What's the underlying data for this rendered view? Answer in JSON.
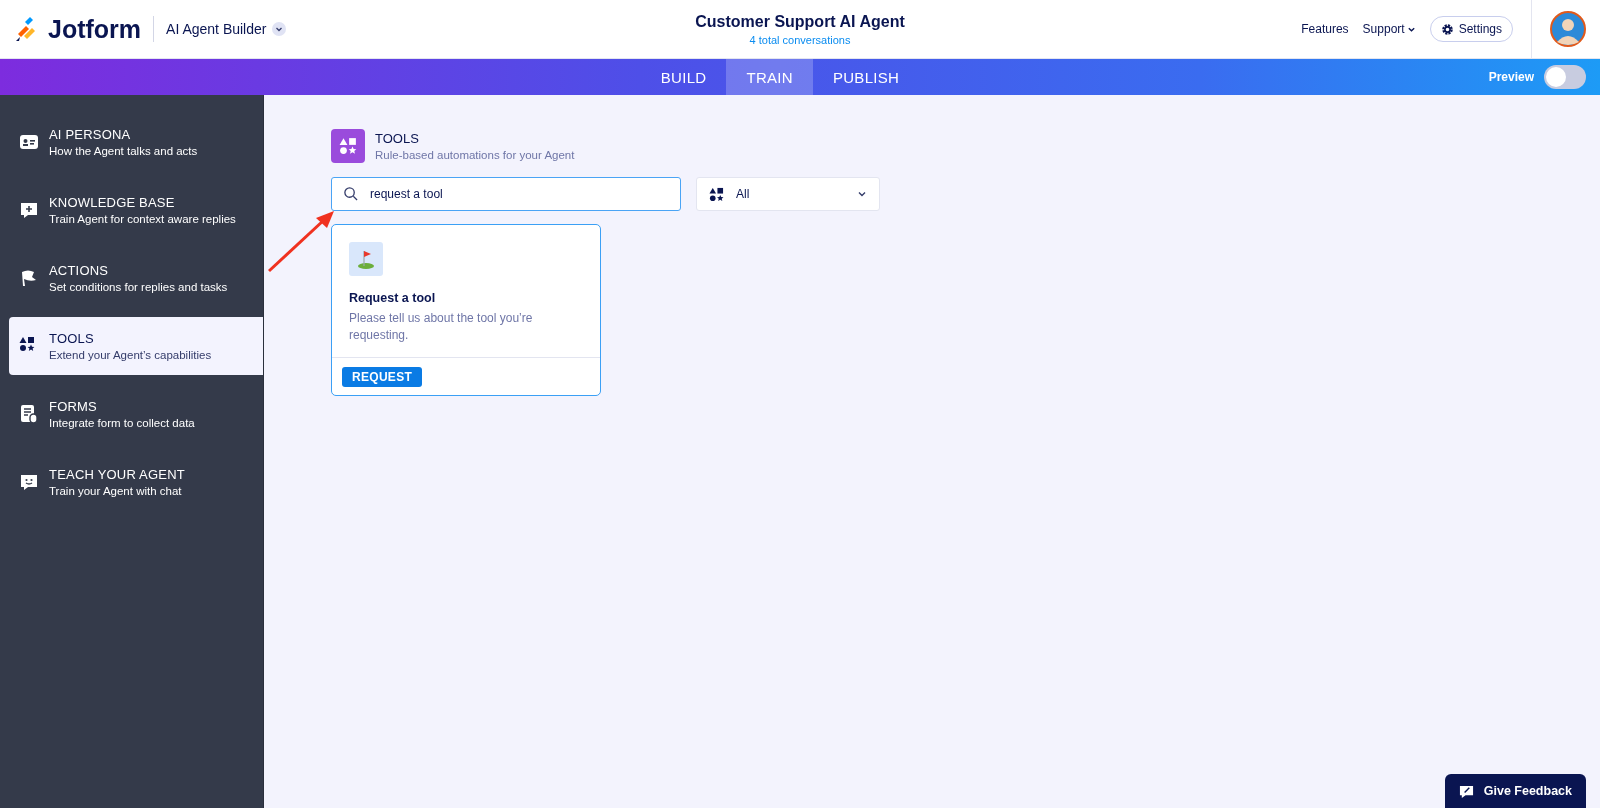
{
  "header": {
    "logo": "Jotform",
    "product": "AI Agent Builder",
    "title": "Customer Support AI Agent",
    "subtitle": "4 total conversations",
    "links": [
      "Features",
      "Support"
    ],
    "settings": "Settings"
  },
  "tabs": [
    {
      "label": "BUILD",
      "selected": false
    },
    {
      "label": "TRAIN",
      "selected": true
    },
    {
      "label": "PUBLISH",
      "selected": false
    }
  ],
  "preview": {
    "label": "Preview",
    "on": false
  },
  "sidebar": {
    "items": [
      {
        "kind": "persona",
        "title": "AI PERSONA",
        "desc": "How the Agent talks and acts",
        "selected": false
      },
      {
        "kind": "knowledge",
        "title": "KNOWLEDGE BASE",
        "desc": "Train Agent for context aware replies",
        "selected": false
      },
      {
        "kind": "actions",
        "title": "ACTIONS",
        "desc": "Set conditions for replies and tasks",
        "selected": false
      },
      {
        "kind": "tools",
        "title": "TOOLS",
        "desc": "Extend your Agent’s capabilities",
        "selected": true
      },
      {
        "kind": "forms",
        "title": "FORMS",
        "desc": "Integrate form to collect data",
        "selected": false
      },
      {
        "kind": "teach",
        "title": "TEACH YOUR AGENT",
        "desc": "Train your Agent with chat",
        "selected": false
      }
    ]
  },
  "section": {
    "title": "TOOLS",
    "subtitle": "Rule-based automations for your Agent"
  },
  "search": {
    "value": "request a tool"
  },
  "filter": {
    "value": "All"
  },
  "cards": [
    {
      "title": "Request a tool",
      "desc": "Please tell us about the tool you’re requesting.",
      "button": "REQUEST"
    }
  ],
  "feedback": "Give Feedback"
}
